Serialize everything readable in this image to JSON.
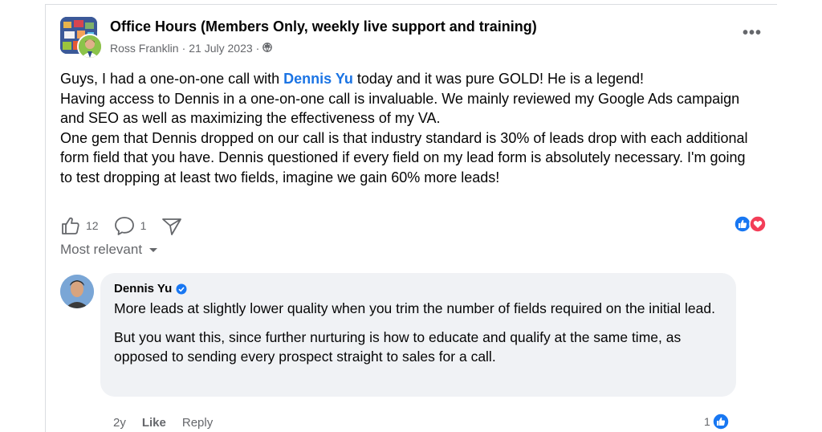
{
  "post": {
    "group_name": "Office Hours (Members Only, weekly live support and training)",
    "author": "Ross Franklin",
    "date": "21 July 2023",
    "more_label": "•••",
    "body": {
      "line1_pre": "Guys, I had a one-on-one call with ",
      "mention": "Dennis Yu",
      "line1_post": " today and it was pure GOLD! He is a legend!",
      "para1_rest": "Having access to Dennis in a one-on-one call is invaluable. We mainly reviewed my Google Ads campaign and SEO as well as maximizing the effectiveness of my VA.",
      "para2": "One gem that Dennis dropped on our call is that industry standard is 30% of leads drop with each additional form field that you have. Dennis questioned if every field on my lead form is absolutely necessary. I'm going to test dropping at least two fields, imagine we gain 60% more leads!"
    },
    "likes_count": "12",
    "comments_count": "1"
  },
  "comments_sort": "Most relevant",
  "comment": {
    "name": "Dennis Yu",
    "text1": "More leads at slightly lower quality when you trim the number of fields required on the initial lead.",
    "text2": "But you want this, since further nurturing is how to educate and qualify at the same time, as opposed to sending every prospect straight to sales for a call.",
    "age": "2y",
    "like_label": "Like",
    "reply_label": "Reply",
    "reaction_count": "1"
  },
  "colors": {
    "link_blue": "#1b74e4",
    "like_blue": "#1877f2",
    "love_red": "#f33e58",
    "secondary_text": "#65676b",
    "bubble_bg": "#f0f2f5"
  }
}
